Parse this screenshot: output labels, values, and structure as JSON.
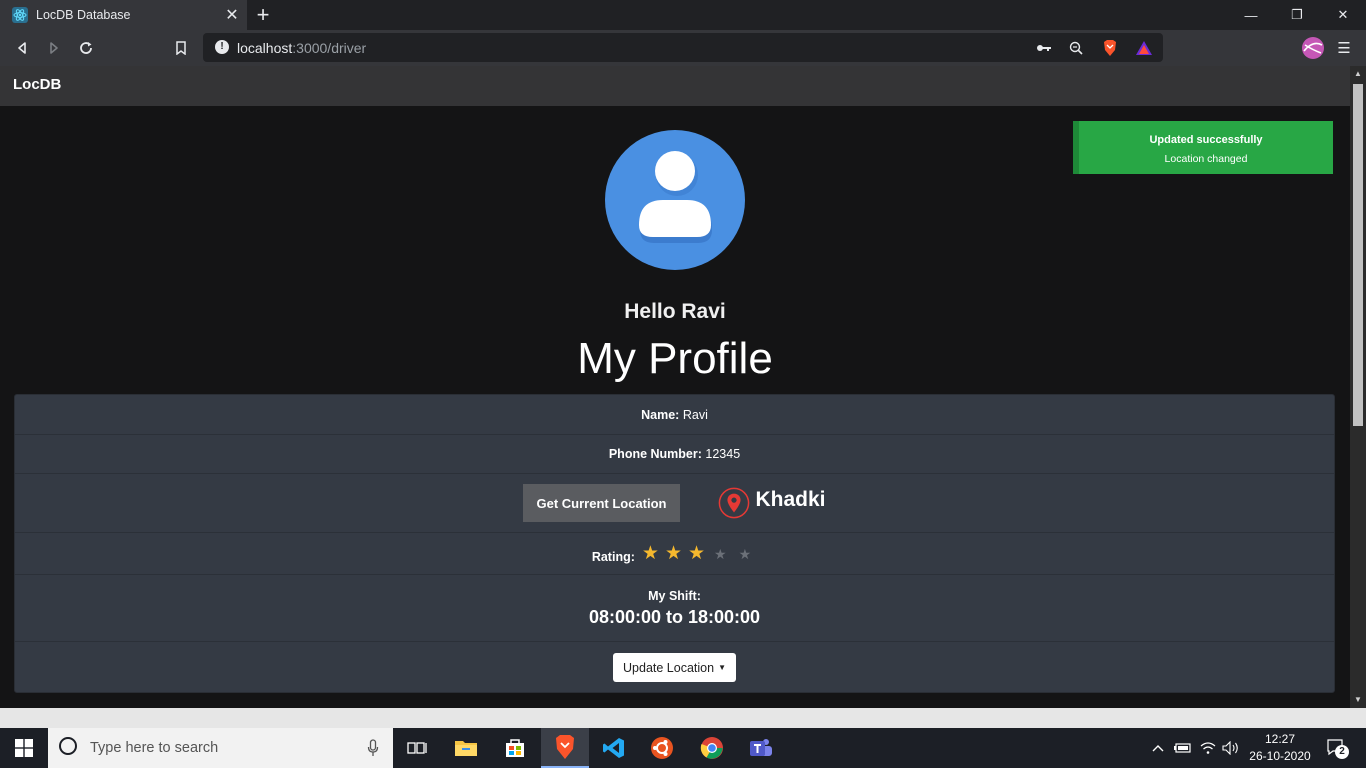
{
  "browser": {
    "tab_title": "LocDB Database",
    "tab_close": "✕",
    "new_tab": "+",
    "url_host": "localhost",
    "url_path": ":3000/driver",
    "win_min": "—",
    "win_restore": "❐",
    "win_close": "✕",
    "menu": "☰"
  },
  "app": {
    "brand": "LocDB",
    "greeting": "Hello Ravi",
    "page_title": "My Profile"
  },
  "toast": {
    "title": "Updated successfully",
    "message": "Location changed",
    "color": "#28a745"
  },
  "profile": {
    "name_label": "Name:",
    "name_value": "Ravi",
    "phone_label": "Phone Number:",
    "phone_value": "12345",
    "get_location_button": "Get Current Location",
    "location": "Khadki",
    "rating_label": "Rating:",
    "rating": 3,
    "rating_max": 5,
    "shift_label": "My Shift:",
    "shift_time": "08:00:00 to 18:00:00",
    "update_location_button": "Update Location"
  },
  "taskbar": {
    "search_placeholder": "Type here to search",
    "time": "12:27",
    "date": "26-10-2020",
    "notifications": "2"
  },
  "colors": {
    "accent_blue": "#4a90e2",
    "star": "#f5b82e",
    "pin": "#e53935"
  }
}
